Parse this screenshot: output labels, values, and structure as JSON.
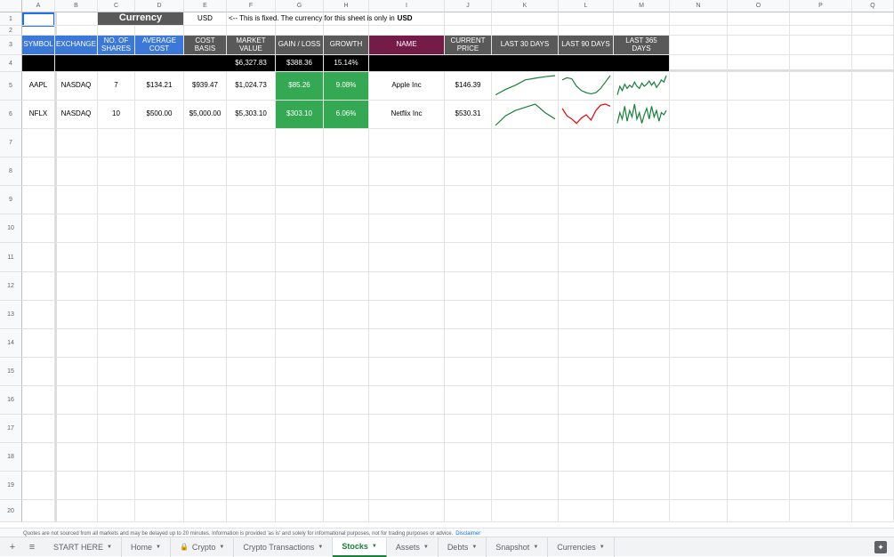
{
  "columns": [
    "A",
    "B",
    "C",
    "D",
    "E",
    "F",
    "G",
    "H",
    "I",
    "J",
    "K",
    "L",
    "M",
    "N",
    "O",
    "P",
    "Q"
  ],
  "rows": [
    "1",
    "2",
    "3",
    "4",
    "5",
    "6",
    "7",
    "8",
    "9",
    "10",
    "11",
    "12",
    "13",
    "14",
    "15",
    "16",
    "17",
    "18",
    "19",
    "20"
  ],
  "row1": {
    "currency_label": "Currency",
    "currency_value": "USD",
    "note": "<-- This is fixed. The currency for this sheet is only in",
    "note_bold": "USD"
  },
  "headers": {
    "symbol": "SYMBOL",
    "exchange": "EXCHANGE",
    "shares": "NO. OF SHARES",
    "avg_cost": "AVERAGE COST",
    "cost_basis": "COST BASIS",
    "market_value": "MARKET VALUE",
    "gain_loss": "GAIN / LOSS",
    "growth": "GROWTH",
    "name": "NAME",
    "current_price": "CURRENT PRICE",
    "last30": "LAST 30 DAYS",
    "last90": "LAST 90 DAYS",
    "last365": "LAST 365 DAYS"
  },
  "totals": {
    "market_value": "$6,327.83",
    "gain_loss": "$388.36",
    "growth": "15.14%"
  },
  "stocks": [
    {
      "symbol": "AAPL",
      "exchange": "NASDAQ",
      "shares": "7",
      "avg_cost": "$134.21",
      "cost_basis": "$939.47",
      "market_value": "$1,024.73",
      "gain_loss": "$85.26",
      "growth": "9.08%",
      "name": "Apple Inc",
      "current_price": "$146.39",
      "spark30": [
        0.1,
        0.35,
        0.55,
        0.8,
        0.88,
        0.95,
        1.0
      ],
      "spark90": [
        0.8,
        0.9,
        0.85,
        0.5,
        0.3,
        0.2,
        0.15,
        0.2,
        0.4,
        0.7,
        1.0
      ],
      "spark365": [
        0.1,
        0.5,
        0.3,
        0.6,
        0.4,
        0.55,
        0.45,
        0.7,
        0.5,
        0.4,
        0.65,
        0.5,
        0.6,
        0.75,
        0.55,
        0.7,
        0.45,
        0.6,
        0.8,
        0.7,
        1.0
      ]
    },
    {
      "symbol": "NFLX",
      "exchange": "NASDAQ",
      "shares": "10",
      "avg_cost": "$500.00",
      "cost_basis": "$5,000.00",
      "market_value": "$5,303.10",
      "gain_loss": "$303.10",
      "growth": "6.06%",
      "name": "Netflix Inc",
      "current_price": "$530.31",
      "spark30": [
        0.0,
        0.45,
        0.7,
        0.85,
        1.0,
        0.6,
        0.3
      ],
      "spark90": [
        0.8,
        0.45,
        0.3,
        0.1,
        0.35,
        0.5,
        0.25,
        0.7,
        0.95,
        1.0,
        0.9
      ],
      "spark365": [
        0.1,
        0.6,
        0.3,
        0.9,
        0.2,
        0.7,
        0.4,
        1.0,
        0.3,
        0.6,
        0.1,
        0.5,
        0.8,
        0.3,
        0.9,
        0.4,
        0.7,
        0.2,
        0.6,
        0.5,
        0.7
      ]
    }
  ],
  "colors": {
    "spark_up": "#188038",
    "spark_down": "#e8000b"
  },
  "footer": {
    "note": "Quotes are not sourced from all markets and may be delayed up to 20 minutes. Information is provided 'as is' and solely for informational purposes, not for trading purposes or advice.",
    "link": "Disclaimer"
  },
  "tabs": [
    {
      "label": "START HERE",
      "active": false,
      "lock": false
    },
    {
      "label": "Home",
      "active": false,
      "lock": false
    },
    {
      "label": "Crypto",
      "active": false,
      "lock": true
    },
    {
      "label": "Crypto Transactions",
      "active": false,
      "lock": false
    },
    {
      "label": "Stocks",
      "active": true,
      "lock": false
    },
    {
      "label": "Assets",
      "active": false,
      "lock": false
    },
    {
      "label": "Debts",
      "active": false,
      "lock": false
    },
    {
      "label": "Snapshot",
      "active": false,
      "lock": false
    },
    {
      "label": "Currencies",
      "active": false,
      "lock": false
    }
  ]
}
